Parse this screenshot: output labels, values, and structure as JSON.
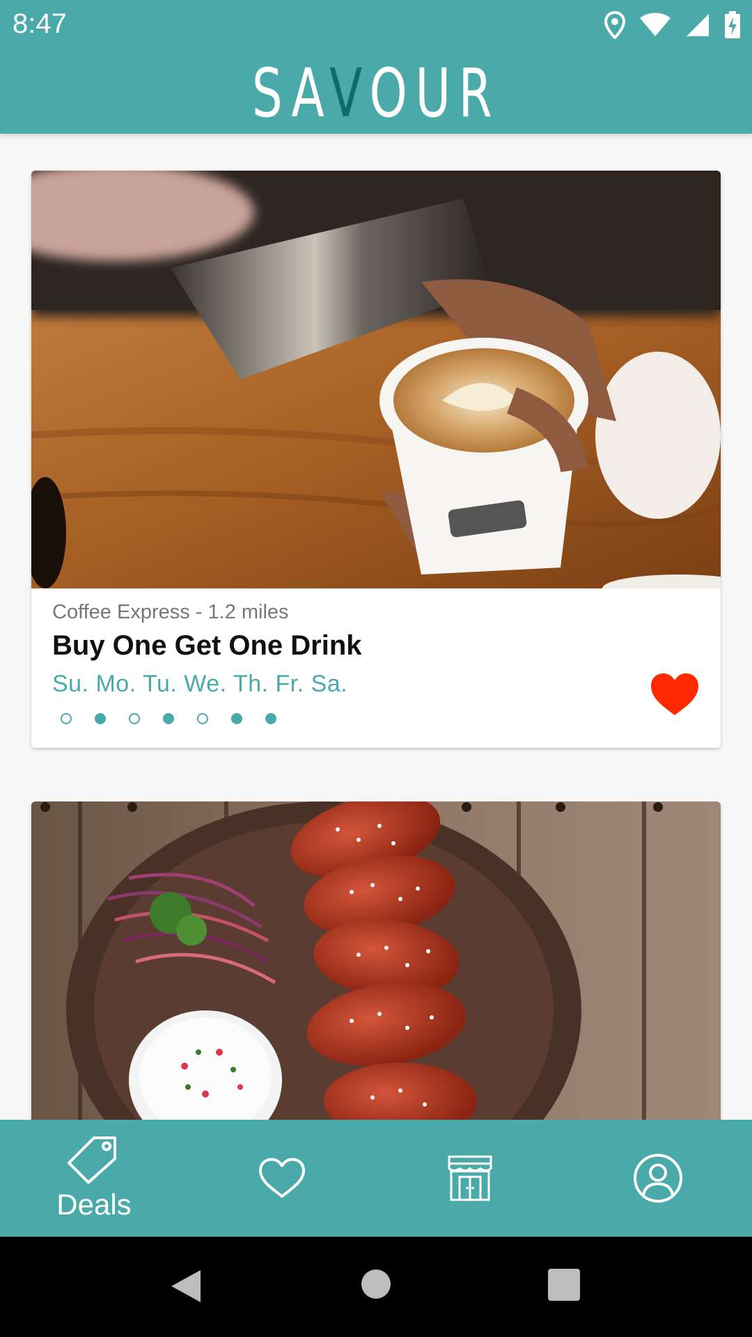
{
  "status_bar": {
    "time": "8:47",
    "icons": [
      "location-icon",
      "wifi-icon",
      "signal-icon",
      "battery-charging-icon"
    ]
  },
  "app": {
    "brand_pre": "SA",
    "brand_accent": "V",
    "brand_post": "OUR",
    "accent_color": "#4aaaa9",
    "brand_accent_color": "#0e6d6b"
  },
  "deals": [
    {
      "image": "latte-art-coffee-photo",
      "store_distance": "Coffee Express - 1.2 miles",
      "title": "Buy One Get One Drink",
      "days": "Su. Mo. Tu. We. Th. Fr. Sa.",
      "active_days": [
        false,
        true,
        false,
        true,
        false,
        true,
        true
      ],
      "favorited": true,
      "heart_color": "#ff2a00"
    },
    {
      "image": "chicken-wings-platter-photo"
    }
  ],
  "bottom_nav": {
    "items": [
      {
        "icon": "tag-icon",
        "label": "Deals",
        "active": true
      },
      {
        "icon": "heart-outline-icon"
      },
      {
        "icon": "storefront-icon"
      },
      {
        "icon": "profile-icon"
      }
    ]
  },
  "system_nav": [
    "back-icon",
    "home-icon",
    "recents-icon"
  ]
}
